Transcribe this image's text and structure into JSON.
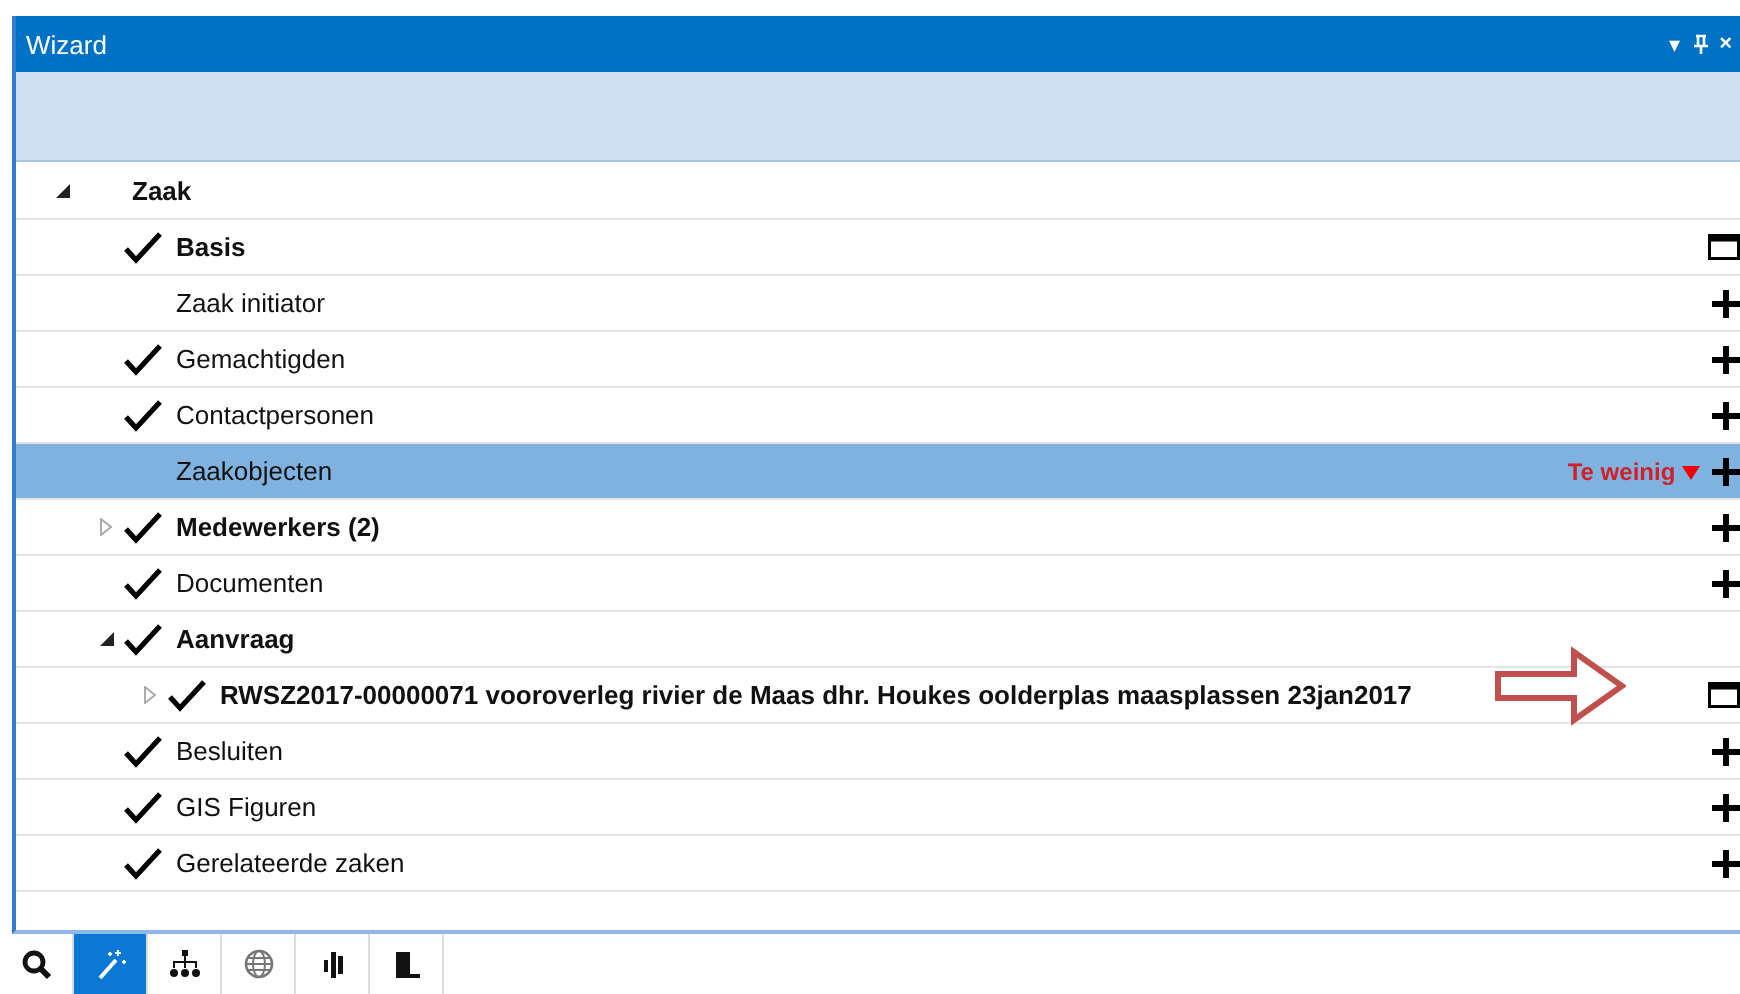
{
  "window": {
    "title": "Wizard",
    "controls": [
      "▾",
      "×"
    ]
  },
  "tree": [
    {
      "label": "Zaak",
      "expanded": true,
      "checked": false,
      "bold": true,
      "selected": false,
      "children": [
        {
          "label": "Basis",
          "checked": true,
          "bold": true,
          "selected": false,
          "kind": "window"
        },
        {
          "label": "Zaak initiator",
          "checked": false,
          "bold": false,
          "selected": false,
          "kind": "add"
        },
        {
          "label": "Gemachtigden",
          "checked": true,
          "bold": false,
          "selected": false,
          "kind": "add"
        },
        {
          "label": "Contactpersonen",
          "checked": true,
          "bold": false,
          "selected": false,
          "kind": "add"
        },
        {
          "label": "Zaakobjecten",
          "checked": false,
          "bold": false,
          "selected": true,
          "kind": "add",
          "warning": "Te weinig"
        },
        {
          "label": "Medewerkers (2)",
          "expanded": false,
          "checked": true,
          "bold": true,
          "selected": false,
          "kind": "add"
        },
        {
          "label": "Documenten",
          "checked": true,
          "bold": false,
          "selected": false,
          "kind": "add"
        },
        {
          "label": "Aanvraag",
          "expanded": true,
          "checked": true,
          "bold": true,
          "selected": false,
          "children": [
            {
              "label": "RWSZ2017-00000071 vooroverleg rivier de Maas dhr. Houkes oolderplas maasplassen 23jan2017",
              "expanded": false,
              "checked": true,
              "bold": true,
              "selected": false,
              "kind": "window"
            }
          ]
        },
        {
          "label": "Besluiten",
          "checked": true,
          "bold": false,
          "selected": false,
          "kind": "add"
        },
        {
          "label": "GIS Figuren",
          "checked": true,
          "bold": false,
          "selected": false,
          "kind": "add"
        },
        {
          "label": "Gerelateerde zaken",
          "checked": true,
          "bold": false,
          "selected": false,
          "kind": "add"
        }
      ]
    }
  ],
  "toolbar": [
    {
      "kind": "search",
      "selected": false
    },
    {
      "kind": "wand",
      "selected": true
    },
    {
      "kind": "hierarchy",
      "selected": false
    },
    {
      "kind": "globe",
      "selected": false
    },
    {
      "kind": "chart",
      "selected": false
    },
    {
      "kind": "panel",
      "selected": false
    }
  ]
}
